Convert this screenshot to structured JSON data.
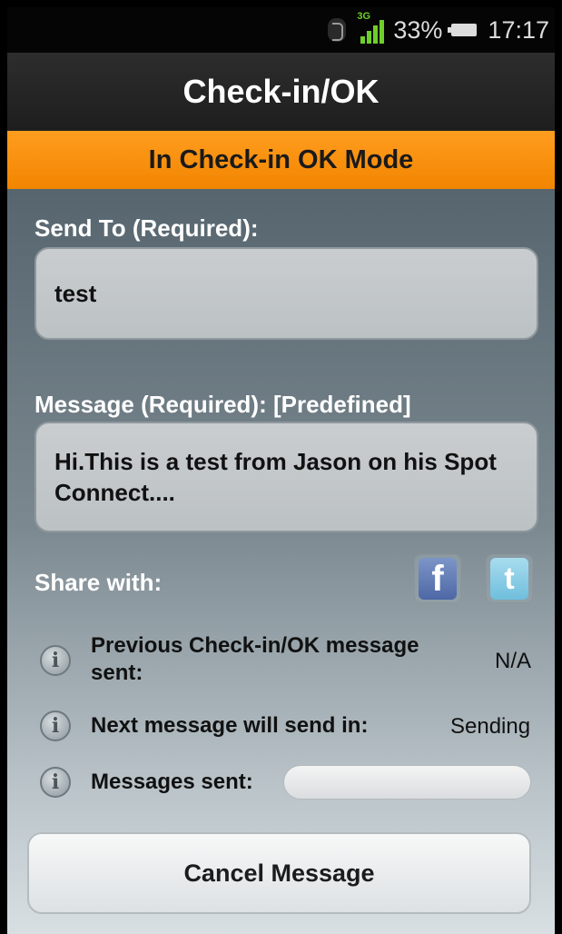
{
  "status_bar": {
    "network_type": "3G",
    "battery_percent": "33%",
    "time": "17:17"
  },
  "app": {
    "title": "Check-in/OK",
    "mode_banner": "In Check-in OK Mode"
  },
  "form": {
    "send_to_label": "Send To (Required):",
    "send_to_value": "test",
    "message_label": "Message (Required): [Predefined]",
    "message_value": "Hi.This is a test from Jason on his Spot Connect....",
    "share_label": "Share with:",
    "share_icons": [
      "facebook-icon",
      "twitter-icon"
    ]
  },
  "info": {
    "previous_label": "Previous Check-in/OK message sent:",
    "previous_value": "N/A",
    "next_label": "Next message will send in:",
    "next_value": "Sending",
    "sent_label": "Messages sent:",
    "sent_progress": 0
  },
  "actions": {
    "cancel_label": "Cancel Message"
  },
  "colors": {
    "accent": "#f28500",
    "status_green": "#6fcf2a"
  }
}
